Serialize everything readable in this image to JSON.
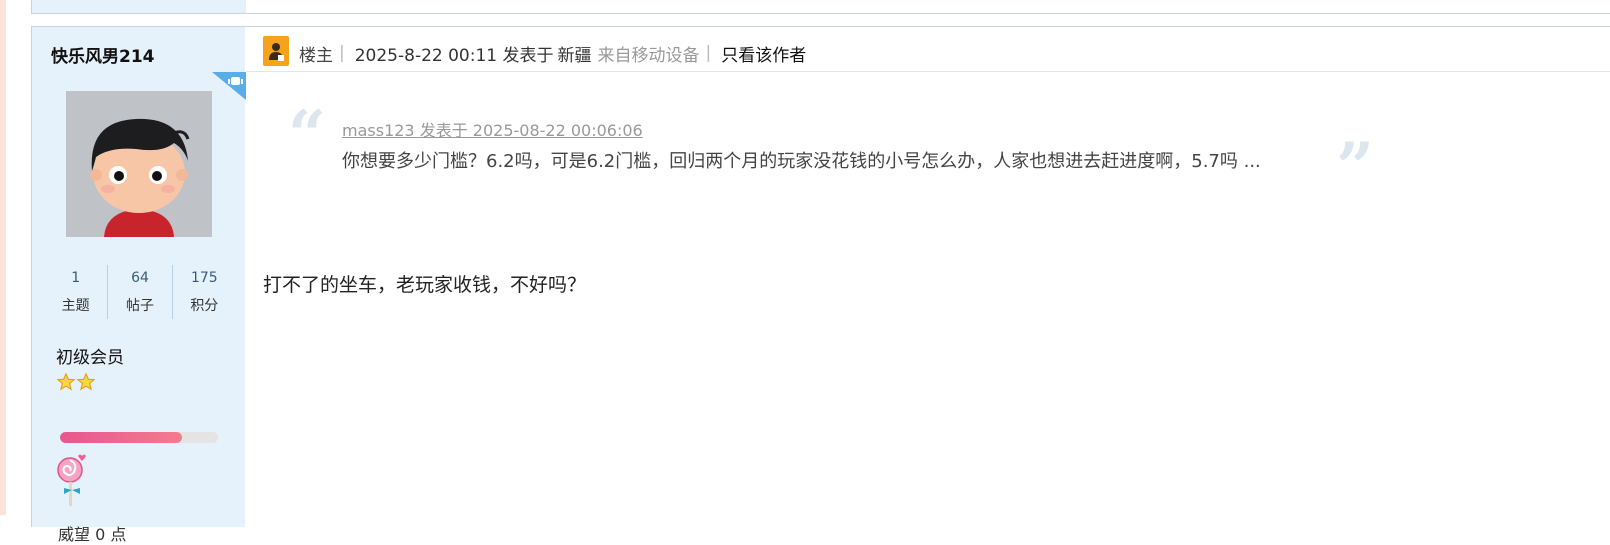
{
  "user": {
    "name": "快乐风男214",
    "stats": [
      {
        "value": "1",
        "label": "主题"
      },
      {
        "value": "64",
        "label": "帖子"
      },
      {
        "value": "175",
        "label": "积分"
      }
    ],
    "rank": "初级会员",
    "stars": 2,
    "level_progress": 0.77,
    "next_line": "威望 0 点"
  },
  "post": {
    "role": "楼主",
    "separator": "|",
    "time": "2025-8-22 00:11 发表于",
    "region": "新疆",
    "source": "来自移动设备",
    "author_only": "只看该作者",
    "quote": {
      "meta": "mass123 发表于 2025-08-22 00:06:06",
      "text": "你想要多少门槛？6.2吗，可是6.2门槛，回归两个月的玩家没花钱的小号怎么办，人家也想进去赶进度啊，5.7吗 ..."
    },
    "message": "打不了的坐车，老玩家收钱，不好吗？"
  },
  "colors": {
    "sidebar_bg": "#e5f1fb",
    "accent_orange": "#f5a21c",
    "progress_pink": "#e8568f"
  }
}
